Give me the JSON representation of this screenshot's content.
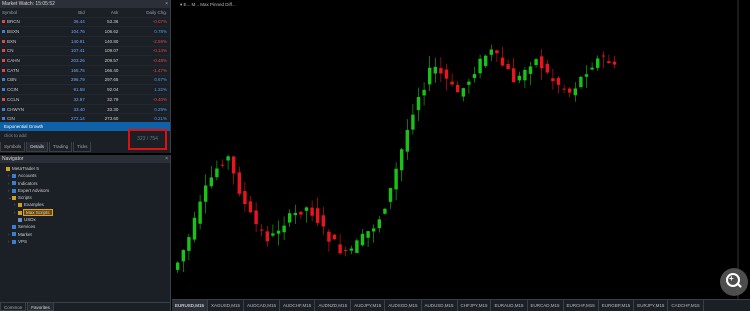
{
  "market_watch": {
    "title": "Market Watch: 15:05:52",
    "close_glyph": "×",
    "columns": [
      "Symbol",
      "Bid",
      "Ask",
      "Daily Chg."
    ],
    "rows": [
      {
        "symbol": "BRCN",
        "bid": "36.44",
        "ask": "53.36",
        "chg": "-0.07%",
        "dir": "dn"
      },
      {
        "symbol": "BSXN",
        "bid": "104.76",
        "ask": "106.62",
        "chg": "0.78%",
        "dir": "up"
      },
      {
        "symbol": "BXN",
        "bid": "140.91",
        "ask": "140.80",
        "chg": "-2.59%",
        "dir": "dn"
      },
      {
        "symbol": "CN",
        "bid": "107.41",
        "ask": "109.07",
        "chg": "-0.14%",
        "dir": "dn"
      },
      {
        "symbol": "CAHN",
        "bid": "203.26",
        "ask": "209.57",
        "chg": "-0.48%",
        "dir": "dn"
      },
      {
        "symbol": "CATN",
        "bid": "165.75",
        "ask": "166.40",
        "chg": "-1.47%",
        "dir": "dn"
      },
      {
        "symbol": "CBN",
        "bid": "296.79",
        "ask": "297.65",
        "chg": "0.67%",
        "dir": "up"
      },
      {
        "symbol": "CCIN",
        "bid": "91.58",
        "ask": "92.04",
        "chg": "1.32%",
        "dir": "up"
      },
      {
        "symbol": "CCLN",
        "bid": "32.97",
        "ask": "32.79",
        "chg": "-0.40%",
        "dir": "dn"
      },
      {
        "symbol": "CHWYN",
        "bid": "33.40",
        "ask": "33.30",
        "chg": "0.29%",
        "dir": "up"
      },
      {
        "symbol": "CIN",
        "bid": "272.14",
        "ask": "273.60",
        "chg": "0.21%",
        "dir": "up"
      }
    ],
    "selected_row": "Exponential Growth",
    "add_placeholder": "click to add",
    "counter": "323 / 754",
    "tabs": [
      "Symbols",
      "Details",
      "Trading",
      "Ticks"
    ]
  },
  "navigator": {
    "title": "Navigator",
    "items": [
      {
        "label": "MetaTrader 5",
        "depth": 0,
        "arrow": "",
        "icon": "#d4a020"
      },
      {
        "label": "Accounts",
        "depth": 1,
        "arrow": "›",
        "icon": "#3a7fd0"
      },
      {
        "label": "Indicators",
        "depth": 1,
        "arrow": "›",
        "icon": "#3a7fd0"
      },
      {
        "label": "Expert Advisors",
        "depth": 1,
        "arrow": "›",
        "icon": "#3a7fd0"
      },
      {
        "label": "Scripts",
        "depth": 1,
        "arrow": "⌄",
        "icon": "#d4a020"
      },
      {
        "label": "Examples",
        "depth": 2,
        "arrow": "›",
        "icon": "#d4a020"
      },
      {
        "label": "Max Scripts",
        "depth": 2,
        "arrow": "›",
        "icon": "#d4a020",
        "selected": true
      },
      {
        "label": "USDx",
        "depth": 2,
        "arrow": "",
        "icon": "#6a8fc0"
      },
      {
        "label": "Services",
        "depth": 1,
        "arrow": "",
        "icon": "#3a7fd0"
      },
      {
        "label": "Market",
        "depth": 1,
        "arrow": "›",
        "icon": "#3a7fd0"
      },
      {
        "label": "VPS",
        "depth": 1,
        "arrow": "›",
        "icon": "#3a7fd0"
      }
    ],
    "tabs": [
      "Common",
      "Favorites"
    ]
  },
  "chart": {
    "title_text": "▾ E... M...  Max Pinned Diff...",
    "up_color": "#19c219",
    "down_color": "#e8141e",
    "tabs": [
      "EURUSD,M15",
      "XAGUSD,M15",
      "AUDCAD,M15",
      "AUDCHF,M15",
      "AUDNZD,M15",
      "AUDJPY,M15",
      "AUDSGD,M15",
      "AUDUSD,M15",
      "CHFJPY,M15",
      "EURAUD,M15",
      "EURCAD,M15",
      "EURCHF,M15",
      "EURGBP,M15",
      "EURJPY,M15",
      "CADCHF,M15"
    ],
    "active_tab": 0,
    "zoom_glyph": "+"
  }
}
